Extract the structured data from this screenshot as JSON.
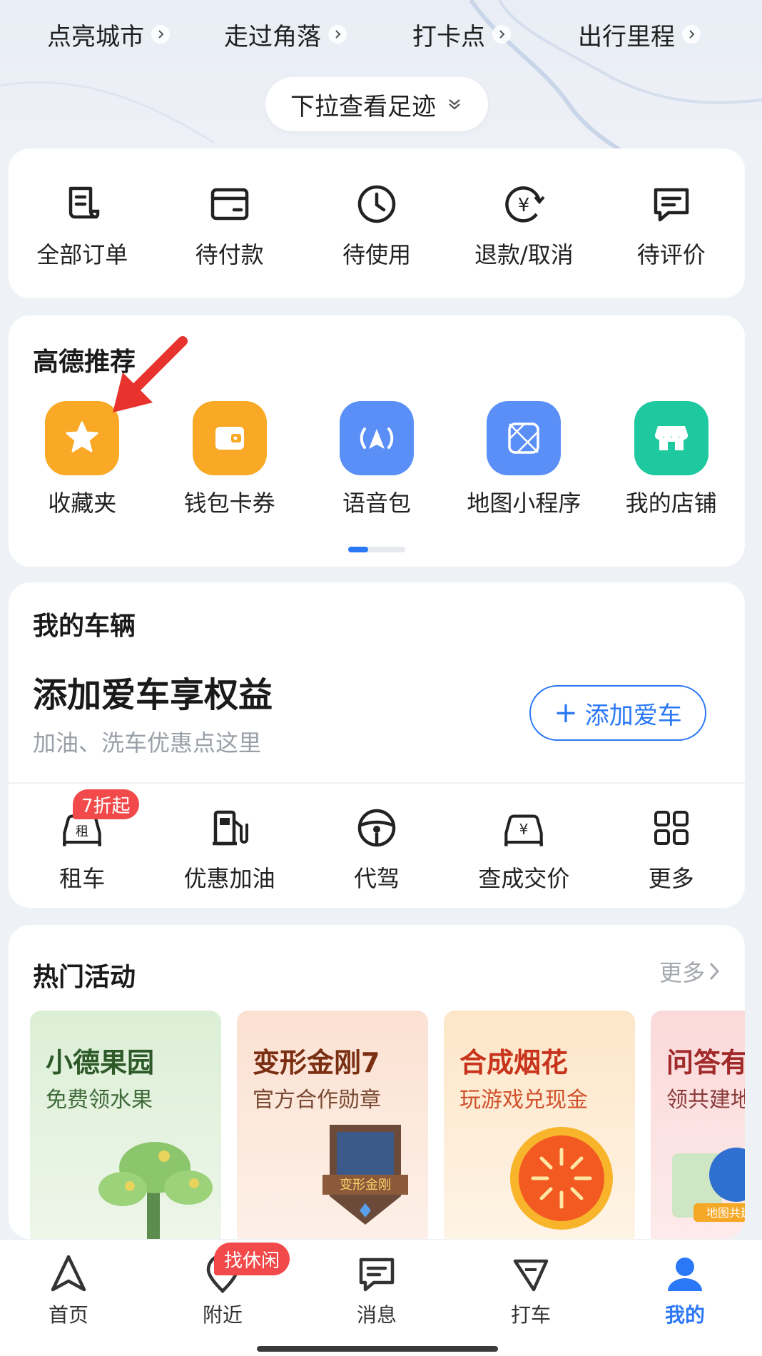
{
  "stats": [
    {
      "label": "点亮城市"
    },
    {
      "label": "走过角落"
    },
    {
      "label": "打卡点"
    },
    {
      "label": "出行里程"
    }
  ],
  "pull_label": "下拉查看足迹",
  "orders": [
    {
      "label": "全部订单",
      "icon": "order-list-icon"
    },
    {
      "label": "待付款",
      "icon": "wallet-card-icon"
    },
    {
      "label": "待使用",
      "icon": "clock-icon"
    },
    {
      "label": "退款/取消",
      "icon": "refund-yen-icon"
    },
    {
      "label": "待评价",
      "icon": "comment-icon"
    }
  ],
  "recommend": {
    "title": "高德推荐",
    "items": [
      {
        "label": "收藏夹",
        "icon": "star-icon",
        "color": "#f9a926"
      },
      {
        "label": "钱包卡券",
        "icon": "wallet-icon",
        "color": "#f9a926"
      },
      {
        "label": "语音包",
        "icon": "voice-navigation-icon",
        "color": "#5a8ff7"
      },
      {
        "label": "地图小程序",
        "icon": "mini-program-icon",
        "color": "#5a8ff7"
      },
      {
        "label": "我的店铺",
        "icon": "store-icon",
        "color": "#1fc9a0"
      }
    ]
  },
  "vehicle": {
    "title": "我的车辆",
    "headline": "添加爱车享权益",
    "subtitle": "加油、洗车优惠点这里",
    "add_button": "添加爱车",
    "services": [
      {
        "label": "租车",
        "icon": "rental-car-icon",
        "badge": "7折起",
        "icon_text": "租"
      },
      {
        "label": "优惠加油",
        "icon": "fuel-pump-icon"
      },
      {
        "label": "代驾",
        "icon": "steering-wheel-icon"
      },
      {
        "label": "查成交价",
        "icon": "car-price-icon",
        "icon_text": "¥"
      },
      {
        "label": "更多",
        "icon": "more-grid-icon"
      }
    ]
  },
  "activities": {
    "title": "热门活动",
    "more": "更多",
    "tiles": [
      {
        "title": "小德果园",
        "subtitle": "免费领水果",
        "title_color": "#2e5a2a",
        "sub_color": "#3f6b3a",
        "bg": "#dff0d8"
      },
      {
        "title": "变形金刚7",
        "subtitle": "官方合作勋章",
        "title_color": "#7a2e12",
        "sub_color": "#7a4a32",
        "bg": "#fbe3d6",
        "art_text": "变形金刚"
      },
      {
        "title": "合成烟花",
        "subtitle": "玩游戏兑现金",
        "title_color": "#c8331c",
        "sub_color": "#d0502b",
        "bg": "#fde9cf"
      },
      {
        "title": "问答有",
        "subtitle": "领共建地",
        "title_color": "#a02a2a",
        "sub_color": "#8a3a3a",
        "bg": "#fbdcdc",
        "art_text": "地图共建"
      }
    ]
  },
  "bottom_nav": {
    "badge": "找休闲",
    "items": [
      {
        "label": "首页",
        "icon": "navigation-arrow-icon"
      },
      {
        "label": "附近",
        "icon": "nearby-location-icon"
      },
      {
        "label": "消息",
        "icon": "message-icon"
      },
      {
        "label": "打车",
        "icon": "taxi-icon"
      },
      {
        "label": "我的",
        "icon": "profile-icon",
        "active": true
      }
    ]
  },
  "colors": {
    "accent": "#2b78f6",
    "badge": "#f24a4a",
    "background": "#eef1f6"
  }
}
